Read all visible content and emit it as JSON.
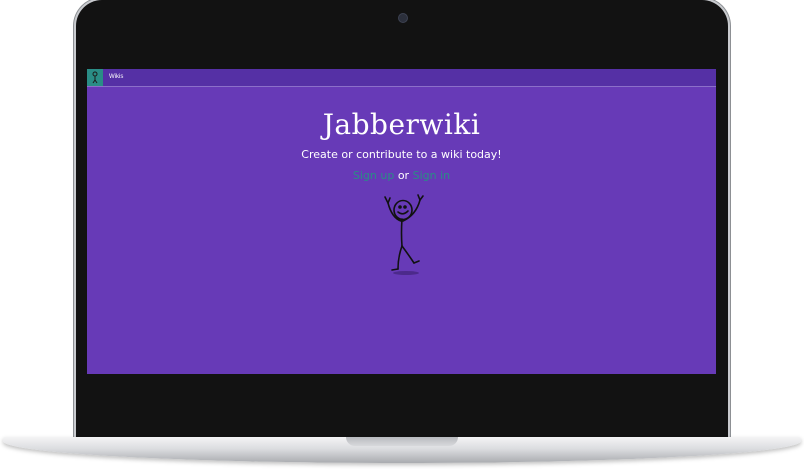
{
  "navbar": {
    "brand_icon": "stick-figure-icon",
    "links": [
      "Wikis"
    ]
  },
  "hero": {
    "title": "Jabberwiki",
    "subtitle": "Create or contribute to a wiki today!",
    "signup_label": "Sign up",
    "connector": "or",
    "signin_label": "Sign in"
  },
  "colors": {
    "screen_background": "#673ab7",
    "navbar_background": "#5530a5",
    "accent_teal": "#2a8d86",
    "text": "#ffffff"
  },
  "illustration": "dancing-stick-figure"
}
